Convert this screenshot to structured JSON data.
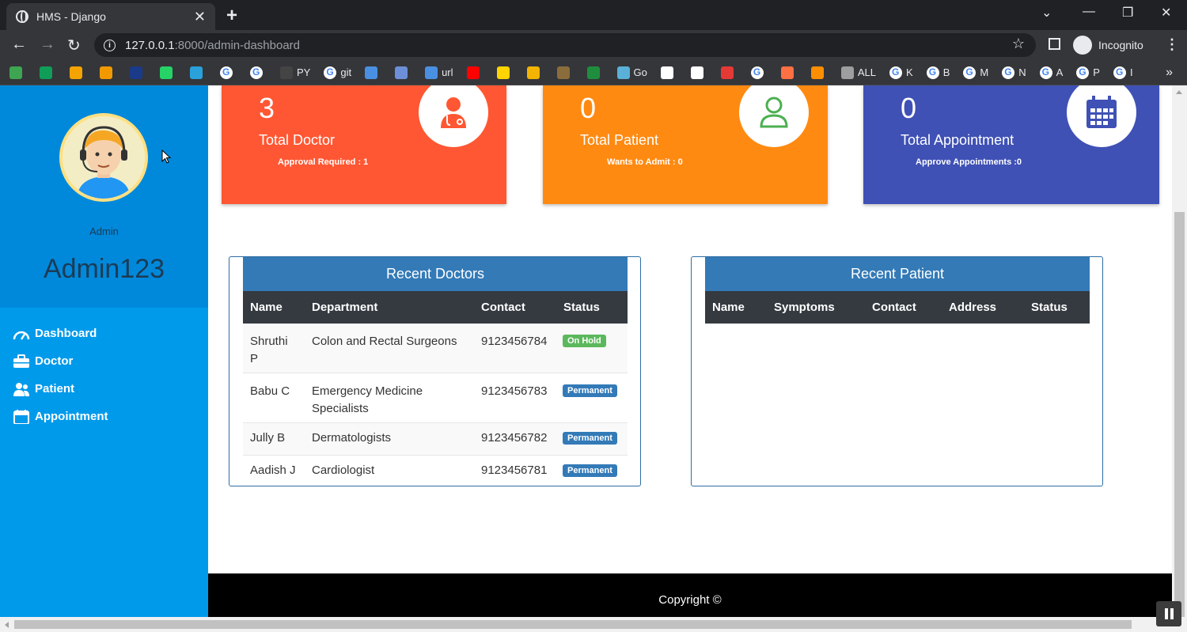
{
  "browser": {
    "tab_title": "HMS - Django",
    "tab_close": "✕",
    "new_tab": "+",
    "url_host": "127.0.0.1",
    "url_rest": ":8000/admin-dashboard",
    "profile_label": "Incognito",
    "bookmarks": [
      {
        "label": "",
        "color": "#3ea652"
      },
      {
        "label": "",
        "color": "#0f9d58"
      },
      {
        "label": "",
        "color": "#f4a300"
      },
      {
        "label": "",
        "color": "#f29900"
      },
      {
        "label": "",
        "color": "#1a3a8a"
      },
      {
        "label": "",
        "color": "#25d366"
      },
      {
        "label": "",
        "color": "#2aa1da"
      },
      {
        "label": "",
        "g": true
      },
      {
        "label": "",
        "g": true
      },
      {
        "label": "PY",
        "color": "#444"
      },
      {
        "label": "git",
        "g": true
      },
      {
        "label": "",
        "color": "#4a90e2"
      },
      {
        "label": "",
        "color": "#6d8fd8"
      },
      {
        "label": "url",
        "color": "#4a90e2"
      },
      {
        "label": "",
        "color": "#ff0000"
      },
      {
        "label": "",
        "color": "#ffd400"
      },
      {
        "label": "",
        "color": "#f2b400"
      },
      {
        "label": "",
        "color": "#8a6d3b"
      },
      {
        "label": "",
        "color": "#1e8e3e"
      },
      {
        "label": "Go",
        "color": "#5ab0d8"
      },
      {
        "label": "",
        "color": "#ffffff"
      },
      {
        "label": "",
        "color": "#ffffff"
      },
      {
        "label": "",
        "color": "#e53935"
      },
      {
        "label": "",
        "g": true
      },
      {
        "label": "",
        "color": "#ff7043"
      },
      {
        "label": "",
        "color": "#ff8f00"
      },
      {
        "label": "ALL",
        "color": "#9e9e9e"
      },
      {
        "label": "K",
        "g": true
      },
      {
        "label": "B",
        "g": true
      },
      {
        "label": "M",
        "g": true
      },
      {
        "label": "N",
        "g": true
      },
      {
        "label": "A",
        "g": true
      },
      {
        "label": "P",
        "g": true
      },
      {
        "label": "I",
        "g": true
      }
    ]
  },
  "sidebar": {
    "role": "Admin",
    "username": "Admin123",
    "items": [
      {
        "label": "Dashboard",
        "icon": "dashboard-icon"
      },
      {
        "label": "Doctor",
        "icon": "briefcase-icon"
      },
      {
        "label": "Patient",
        "icon": "users-icon"
      },
      {
        "label": "Appointment",
        "icon": "calendar-icon"
      }
    ]
  },
  "cards": [
    {
      "count": "3",
      "label": "Total Doctor",
      "sub": "Approval Required : 1",
      "color": "#ff5733",
      "icon": "doctor-icon",
      "icon_color": "#ff5733"
    },
    {
      "count": "0",
      "label": "Total Patient",
      "sub": "Wants to Admit : 0",
      "color": "#ff8a12",
      "icon": "patient-icon",
      "icon_color": "#4caf50"
    },
    {
      "count": "0",
      "label": "Total Appointment",
      "sub": "Approve Appointments :0",
      "color": "#3f51b5",
      "icon": "calendar-icon",
      "icon_color": "#3f51b5"
    }
  ],
  "recent_doctors": {
    "title": "Recent Doctors",
    "columns": [
      "Name",
      "Department",
      "Contact",
      "Status"
    ],
    "rows": [
      {
        "name": "Shruthi P",
        "department": "Colon and Rectal Surgeons",
        "contact": "9123456784",
        "status": "On Hold"
      },
      {
        "name": "Babu C",
        "department": "Emergency Medicine Specialists",
        "contact": "9123456783",
        "status": "Permanent"
      },
      {
        "name": "Jully B",
        "department": "Dermatologists",
        "contact": "9123456782",
        "status": "Permanent"
      },
      {
        "name": "Aadish J",
        "department": "Cardiologist",
        "contact": "9123456781",
        "status": "Permanent"
      }
    ]
  },
  "recent_patient": {
    "title": "Recent Patient",
    "columns": [
      "Name",
      "Symptoms",
      "Contact",
      "Address",
      "Status"
    ]
  },
  "footer": {
    "text": "Copyright ©"
  }
}
